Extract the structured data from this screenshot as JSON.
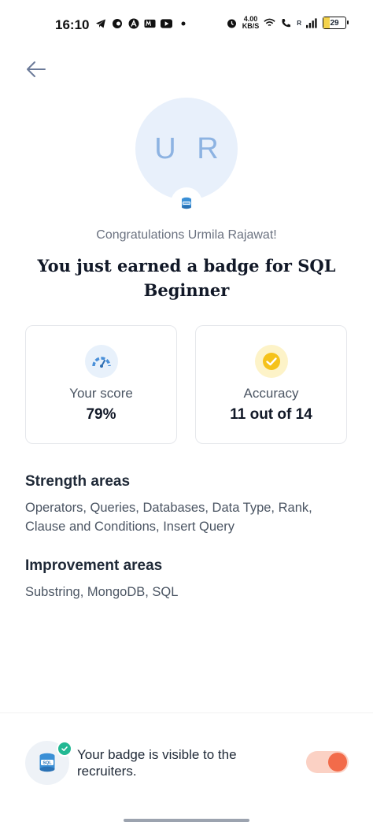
{
  "status_bar": {
    "time": "16:10",
    "net_speed_value": "4.00",
    "net_speed_unit": "KB/S",
    "signal_label": "R",
    "battery": "29",
    "icons": [
      "telegram-icon",
      "app-icon",
      "app-icon",
      "myntra-icon",
      "youtube-icon",
      "dot-icon",
      "alarm-icon",
      "wifi-icon",
      "wifi-call-icon",
      "signal-icon"
    ]
  },
  "profile": {
    "initials": "U R",
    "badge_icon": "sql-database-icon"
  },
  "congrats_text": "Congratulations Urmila Rajawat!",
  "headline": "You just earned a badge for SQL Beginner",
  "stats": {
    "score": {
      "label": "Your score",
      "value": "79%",
      "icon": "speedometer-icon"
    },
    "accuracy": {
      "label": "Accuracy",
      "value": "11 out of 14",
      "icon": "check-circle-icon"
    }
  },
  "strength": {
    "title": "Strength areas",
    "text": "Operators, Queries, Databases, Data Type, Rank, Clause and Conditions, Insert Query"
  },
  "improvement": {
    "title": "Improvement areas",
    "text": "Substring, MongoDB, SQL"
  },
  "footer": {
    "visibility_text": "Your badge is visible to the recruiters.",
    "toggle_on": true
  },
  "colors": {
    "accent": "#f26b4a",
    "avatar_bg": "#e8f0fb",
    "avatar_text": "#8db3e2",
    "accuracy_icon": "#f5c21b",
    "check_badge": "#22b893"
  }
}
